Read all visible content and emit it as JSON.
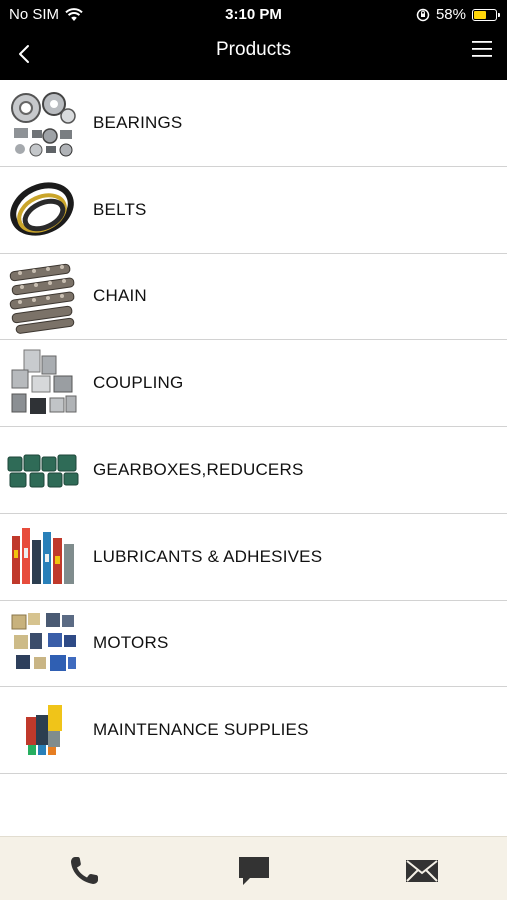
{
  "status": {
    "carrier": "No SIM",
    "time": "3:10 PM",
    "battery": "58%",
    "battery_level": 0.58
  },
  "nav": {
    "title": "Products"
  },
  "products": [
    {
      "label": "BEARINGS"
    },
    {
      "label": "BELTS"
    },
    {
      "label": "CHAIN"
    },
    {
      "label": "COUPLING"
    },
    {
      "label": "GEARBOXES,REDUCERS"
    },
    {
      "label": "LUBRICANTS & ADHESIVES"
    },
    {
      "label": "MOTORS"
    },
    {
      "label": "MAINTENANCE SUPPLIES"
    }
  ],
  "tabbar": {
    "icons": [
      "phone-icon",
      "chat-icon",
      "mail-icon"
    ]
  },
  "colors": {
    "bar_bg": "#000000",
    "tabbar_bg": "#f5f1e7",
    "battery": "#ffd60a"
  }
}
